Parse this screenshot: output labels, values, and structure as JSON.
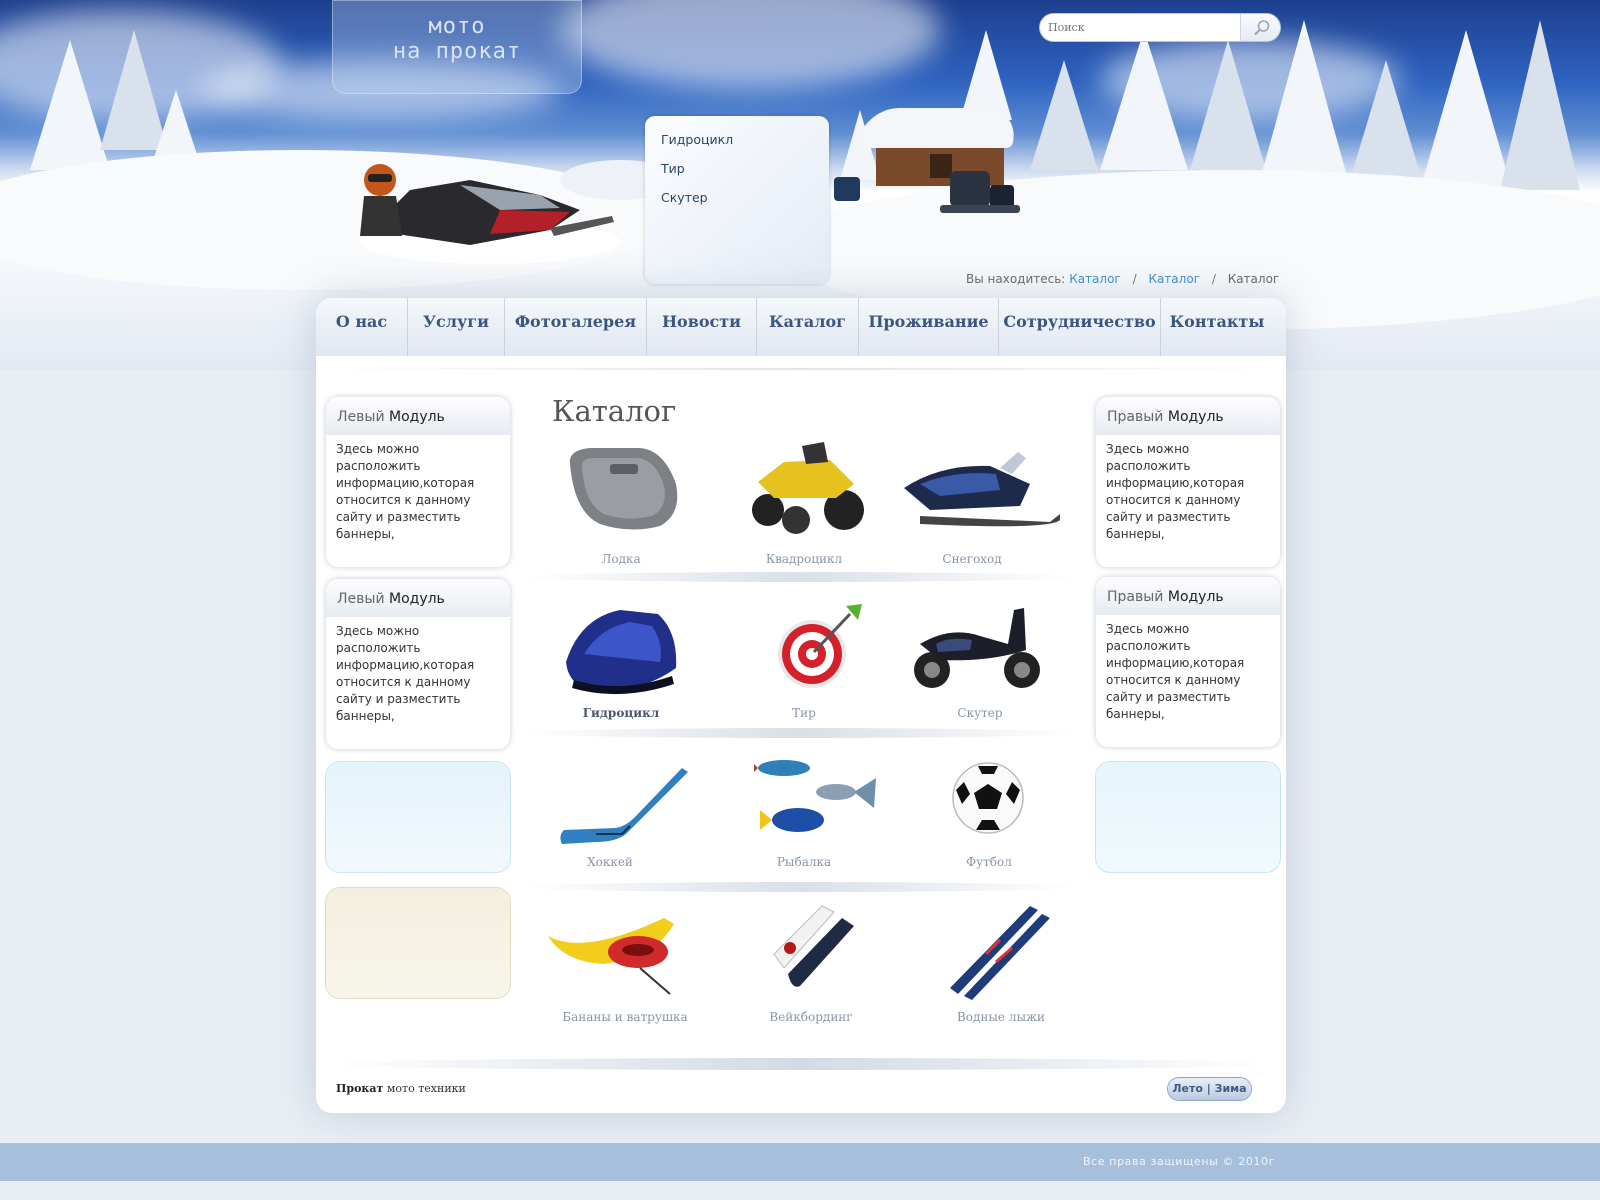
{
  "site": {
    "logo_line1": "мото",
    "logo_line2": "на прокат"
  },
  "search": {
    "placeholder": "Поиск",
    "button_icon": "magnifier-icon"
  },
  "dropdown": {
    "items": [
      "Гидроцикл",
      "Тир",
      "Скутер"
    ]
  },
  "breadcrumb": {
    "prefix": "Вы находитесь:",
    "items": [
      "Каталог",
      "Каталог",
      "Каталог"
    ],
    "separator": "/"
  },
  "nav": {
    "items": [
      "О нас",
      "Услуги",
      "Фотогалерея",
      "Новости",
      "Каталог",
      "Проживание",
      "Сотрудничество",
      "Контакты"
    ]
  },
  "left_modules": [
    {
      "title_light": "Левый",
      "title_bold": "Модуль",
      "text": "Здесь можно расположить информацию,которая относится к данному сайту и разместить баннеры,"
    },
    {
      "title_light": "Левый",
      "title_bold": "Модуль",
      "text": "Здесь можно расположить информацию,которая относится к данному сайту и разместить баннеры,"
    }
  ],
  "right_modules": [
    {
      "title_light": "Правый",
      "title_bold": "Модуль",
      "text": "Здесь можно расположить информацию,которая относится к данному сайту и разместить баннеры,"
    },
    {
      "title_light": "Правый",
      "title_bold": "Модуль",
      "text": "Здесь можно расположить информацию,которая относится к данному сайту и разместить баннеры,"
    }
  ],
  "catalog": {
    "title": "Каталог",
    "items": [
      {
        "label": "Лодка",
        "icon": "boat-icon"
      },
      {
        "label": "Квадроцикл",
        "icon": "atv-icon"
      },
      {
        "label": "Снегоход",
        "icon": "snowmobile-icon"
      },
      {
        "label": "Гидроцикл",
        "icon": "jetski-icon",
        "active": true
      },
      {
        "label": "Тир",
        "icon": "target-icon"
      },
      {
        "label": "Скутер",
        "icon": "scooter-icon"
      },
      {
        "label": "Хоккей",
        "icon": "hockey-stick-icon"
      },
      {
        "label": "Рыбалка",
        "icon": "fish-icon"
      },
      {
        "label": "Футбол",
        "icon": "soccer-ball-icon"
      },
      {
        "label": "Бананы и ватрушка",
        "icon": "banana-boat-icon"
      },
      {
        "label": "Вейкбординг",
        "icon": "wakeboard-icon"
      },
      {
        "label": "Водные лыжи",
        "icon": "water-ski-icon"
      }
    ]
  },
  "footer": {
    "brand_bold": "Прокат",
    "brand_rest": "мото техники",
    "season_switch": "Лето | Зима",
    "copyright": "Все права защищены © 2010г"
  },
  "colors": {
    "accent_link": "#3a8fd0",
    "nav_text": "#3b5680",
    "bottom_bar": "#a6bfdc"
  }
}
